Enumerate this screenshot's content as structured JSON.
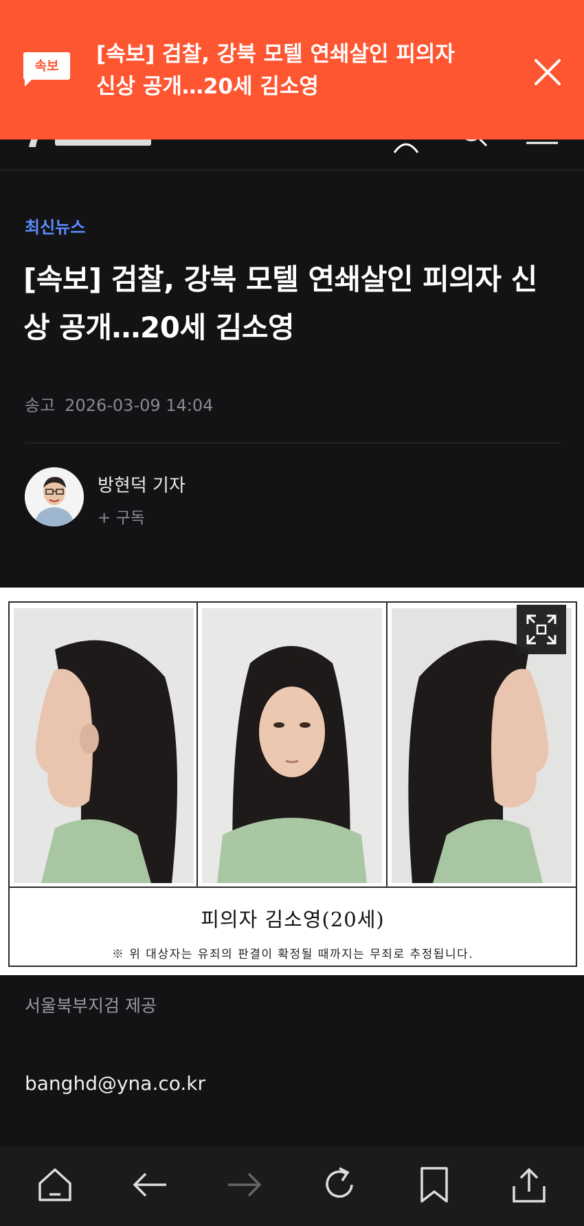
{
  "alert": {
    "badge": "속보",
    "text": "[속보] 검찰, 강북 모텔 연쇄살인 피의자 신상 공개…20세 김소영"
  },
  "article": {
    "category": "최신뉴스",
    "title": "[속보] 검찰, 강북 모텔 연쇄살인 피의자 신상 공개…20세 김소영",
    "date_label": "송고",
    "date": "2026-03-09 14:04",
    "reporter": "방현덕 기자",
    "subscribe": "+ 구독"
  },
  "photo": {
    "caption_name": "피의자  김소영(20세)",
    "caption_note": "※ 위 대상자는 유죄의 판결이 확정될 때까지는 무죄로 추정됩니다."
  },
  "source": "서울북부지검 제공",
  "email": "banghd@yna.co.kr",
  "colors": {
    "alert_bg": "#ff5632",
    "category": "#5b8cff",
    "page_bg": "#131315"
  },
  "icons": [
    "logo-icon",
    "user-icon",
    "search-icon",
    "menu-icon",
    "close-icon",
    "expand-icon",
    "home-icon",
    "back-arrow-icon",
    "forward-arrow-icon",
    "refresh-icon",
    "bookmark-icon",
    "share-icon"
  ]
}
